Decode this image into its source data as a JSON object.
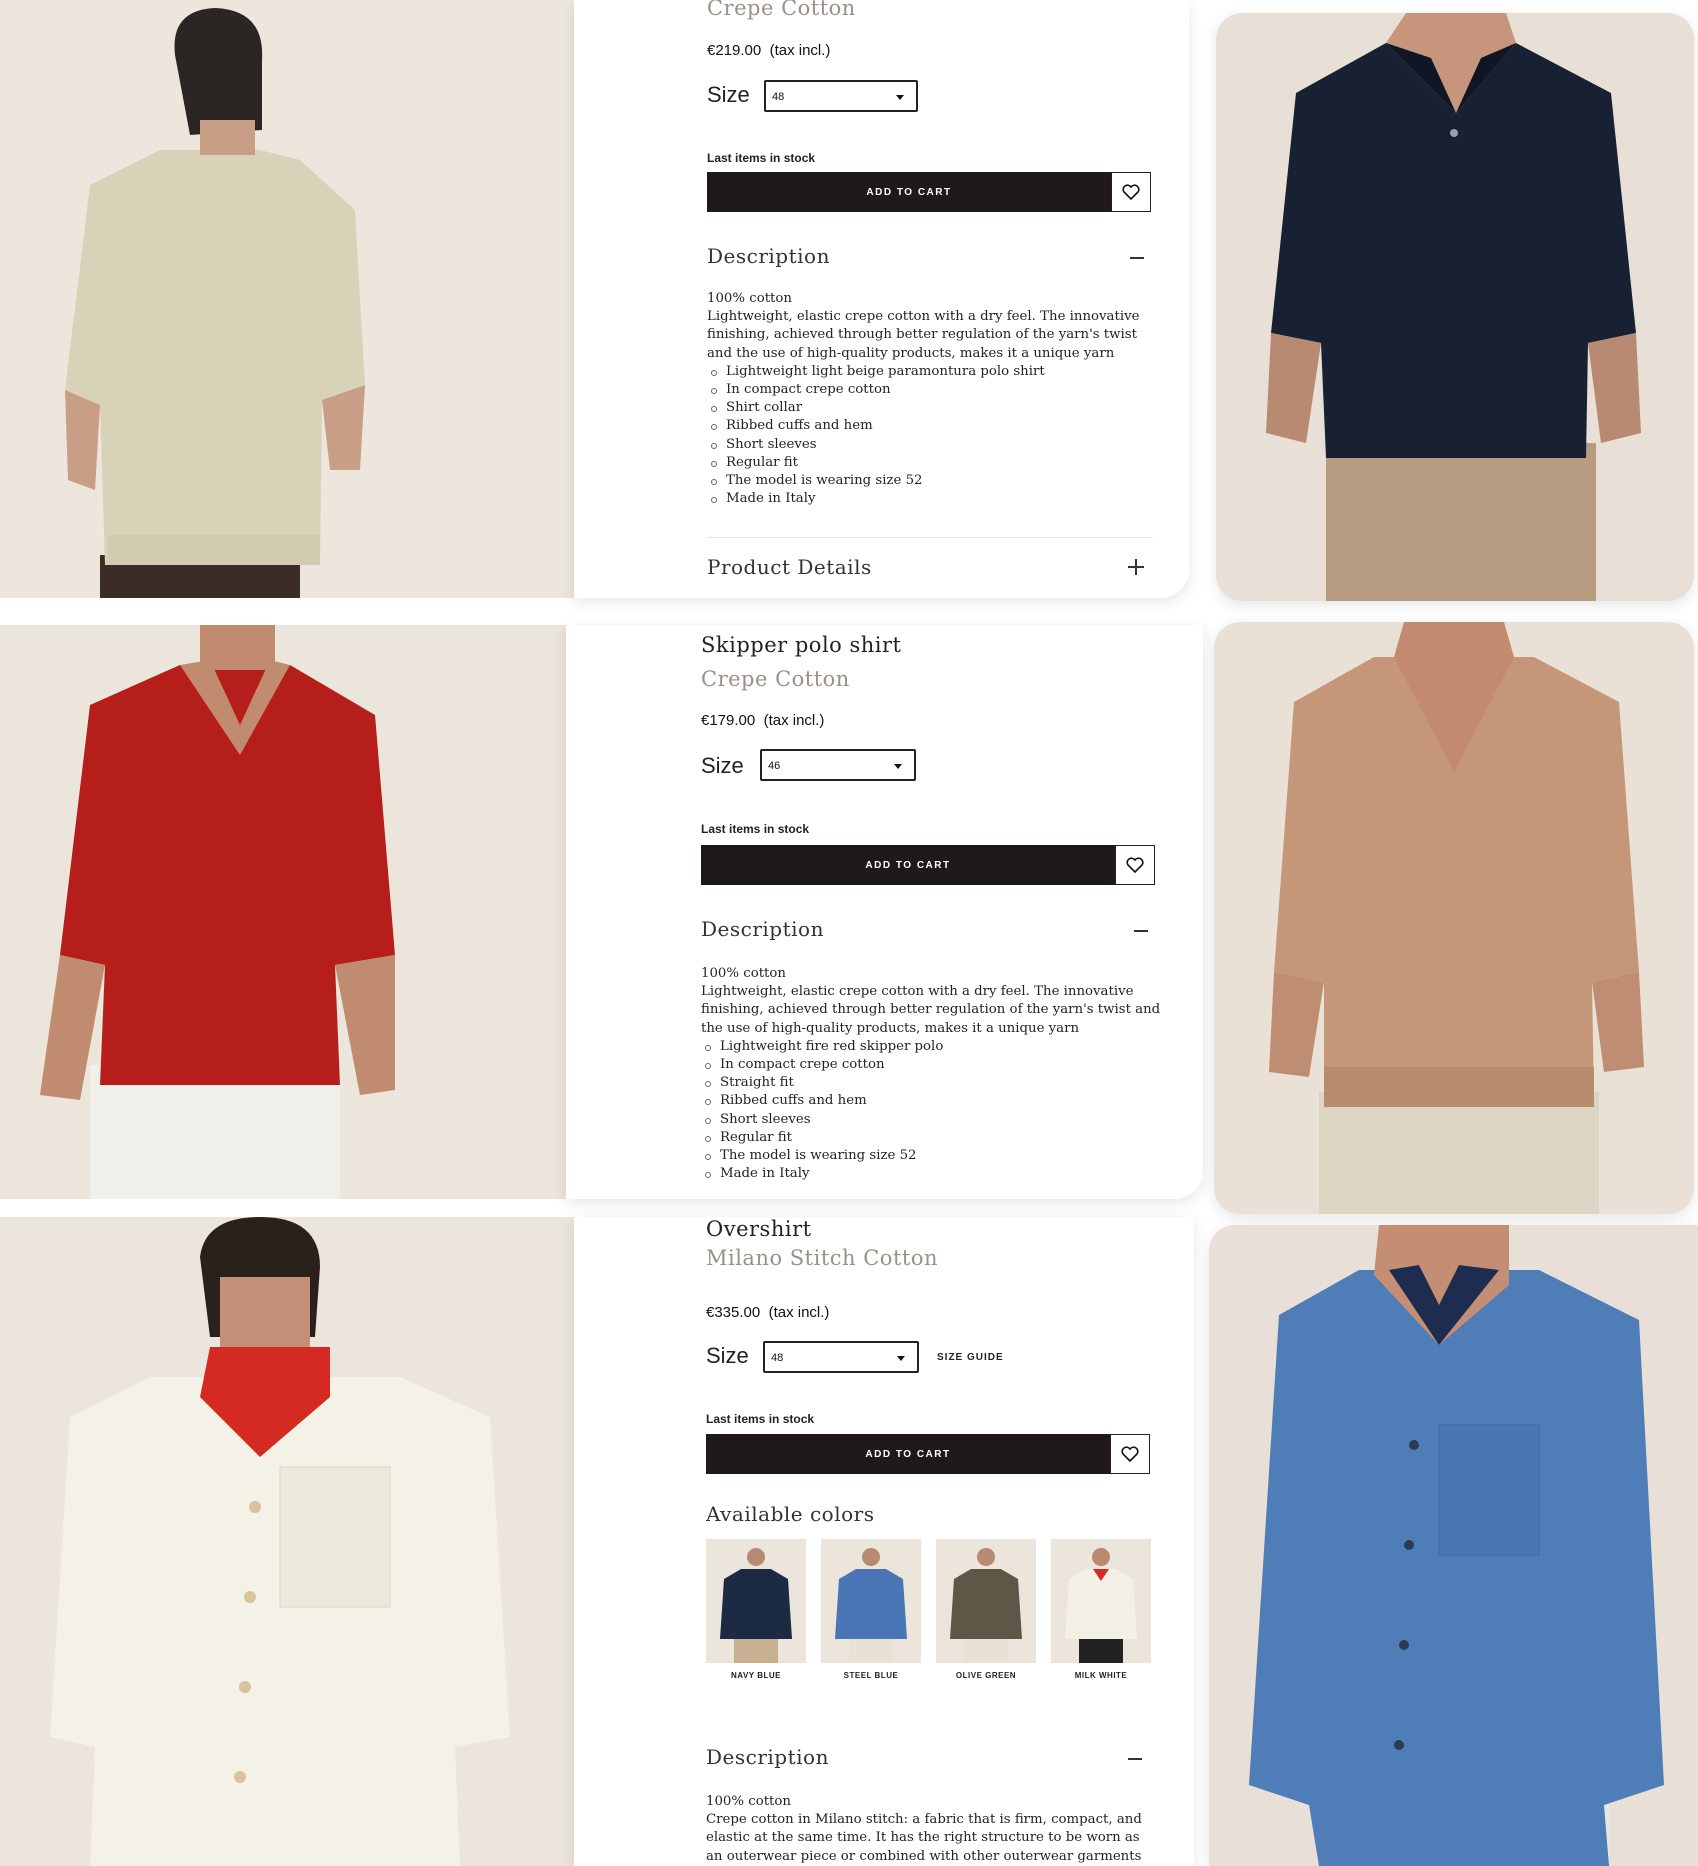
{
  "products": [
    {
      "subtitle": "Crepe Cotton",
      "price": "€219.00",
      "tax": "(tax incl.)",
      "size_label": "Size",
      "size_value": "48",
      "stock_text": "Last items in stock",
      "add_to_cart": "ADD TO CART",
      "description_title": "Description",
      "desc_lines": [
        "100% cotton",
        "Lightweight, elastic crepe cotton with a dry feel. The innovative finishing, achieved through better regulation of the yarn's twist and the use of high-quality products, makes it a unique yarn"
      ],
      "bullets": [
        "Lightweight light beige paramontura polo shirt",
        "In compact crepe cotton",
        "Shirt collar",
        "Ribbed cuffs and hem",
        "Short sleeves",
        "Regular fit",
        "The model is wearing size 52",
        "Made in Italy"
      ],
      "details_title": "Product Details"
    },
    {
      "title": "Skipper polo shirt",
      "subtitle": "Crepe Cotton",
      "price": "€179.00",
      "tax": "(tax incl.)",
      "size_label": "Size",
      "size_value": "46",
      "stock_text": "Last items in stock",
      "add_to_cart": "ADD TO CART",
      "description_title": "Description",
      "desc_lines": [
        "100% cotton",
        "Lightweight, elastic crepe cotton with a dry feel. The innovative finishing, achieved through better regulation of the yarn's twist and the use of high-quality products, makes it a unique yarn"
      ],
      "bullets": [
        "Lightweight fire red skipper polo",
        "In compact crepe cotton",
        "Straight fit",
        "Ribbed cuffs and hem",
        "Short sleeves",
        "Regular fit",
        "The model is wearing size 52",
        "Made in Italy"
      ]
    },
    {
      "title": "Overshirt",
      "subtitle": "Milano Stitch Cotton",
      "price": "€335.00",
      "tax": "(tax incl.)",
      "size_label": "Size",
      "size_value": "48",
      "size_guide": "SIZE GUIDE",
      "stock_text": "Last items in stock",
      "add_to_cart": "ADD TO CART",
      "colors_title": "Available colors",
      "colors": [
        {
          "name": "NAVY BLUE",
          "color": "#1c2a44"
        },
        {
          "name": "STEEL BLUE",
          "color": "#4a76b5"
        },
        {
          "name": "OLIVE GREEN",
          "color": "#5e5748"
        },
        {
          "name": "MILK WHITE",
          "color": "#f3f0e6"
        }
      ],
      "description_title": "Description",
      "desc_lines": [
        "100% cotton",
        "Crepe cotton in Milano stitch: a fabric that is firm, compact, and elastic at the same time. It has the right structure to be worn as an outerwear piece or combined with other outerwear garments"
      ]
    }
  ],
  "icons": {
    "wishlist": "heart-icon",
    "dropdown": "caret-down-icon",
    "collapse": "minus-icon",
    "expand": "plus-icon"
  },
  "colors": {
    "background": "#f1ece6",
    "button": "#1f1a19",
    "subtitle": "#999187"
  }
}
